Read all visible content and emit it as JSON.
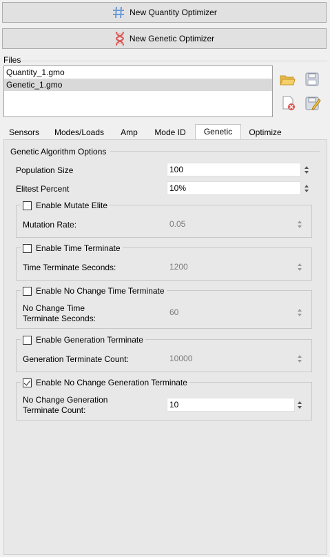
{
  "buttons": {
    "new_quantity": "New Quantity Optimizer",
    "new_genetic": "New Genetic Optimizer"
  },
  "files": {
    "label": "Files",
    "items": [
      {
        "name": "Quantity_1.gmo",
        "selected": false
      },
      {
        "name": "Genetic_1.gmo",
        "selected": true
      }
    ]
  },
  "tabs": [
    "Sensors",
    "Modes/Loads",
    "Amp",
    "Mode ID",
    "Genetic",
    "Optimize"
  ],
  "active_tab": "Genetic",
  "genetic": {
    "group_title": "Genetic Algorithm Options",
    "population_label": "Population Size",
    "population_value": "100",
    "elitest_label": "Elitest Percent",
    "elitest_value": "10%",
    "mutate": {
      "check_label": "Enable Mutate Elite",
      "checked": false,
      "field_label": "Mutation Rate:",
      "value": "0.05"
    },
    "time": {
      "check_label": "Enable Time Terminate",
      "checked": false,
      "field_label": "Time Terminate Seconds:",
      "value": "1200"
    },
    "nochange_time": {
      "check_label": "Enable No Change Time Terminate",
      "checked": false,
      "field_label_1": "No Change Time",
      "field_label_2": "Terminate Seconds:",
      "value": "60"
    },
    "generation": {
      "check_label": "Enable Generation Terminate",
      "checked": false,
      "field_label": "Generation Terminate Count:",
      "value": "10000"
    },
    "nochange_gen": {
      "check_label": "Enable No Change Generation Terminate",
      "checked": true,
      "field_label_1": "No Change Generation",
      "field_label_2": "Terminate Count:",
      "value": "10"
    }
  },
  "colors": {
    "selection": "#d9d9d9",
    "panel": "#e8e8e8",
    "button": "#e1e1e1"
  }
}
